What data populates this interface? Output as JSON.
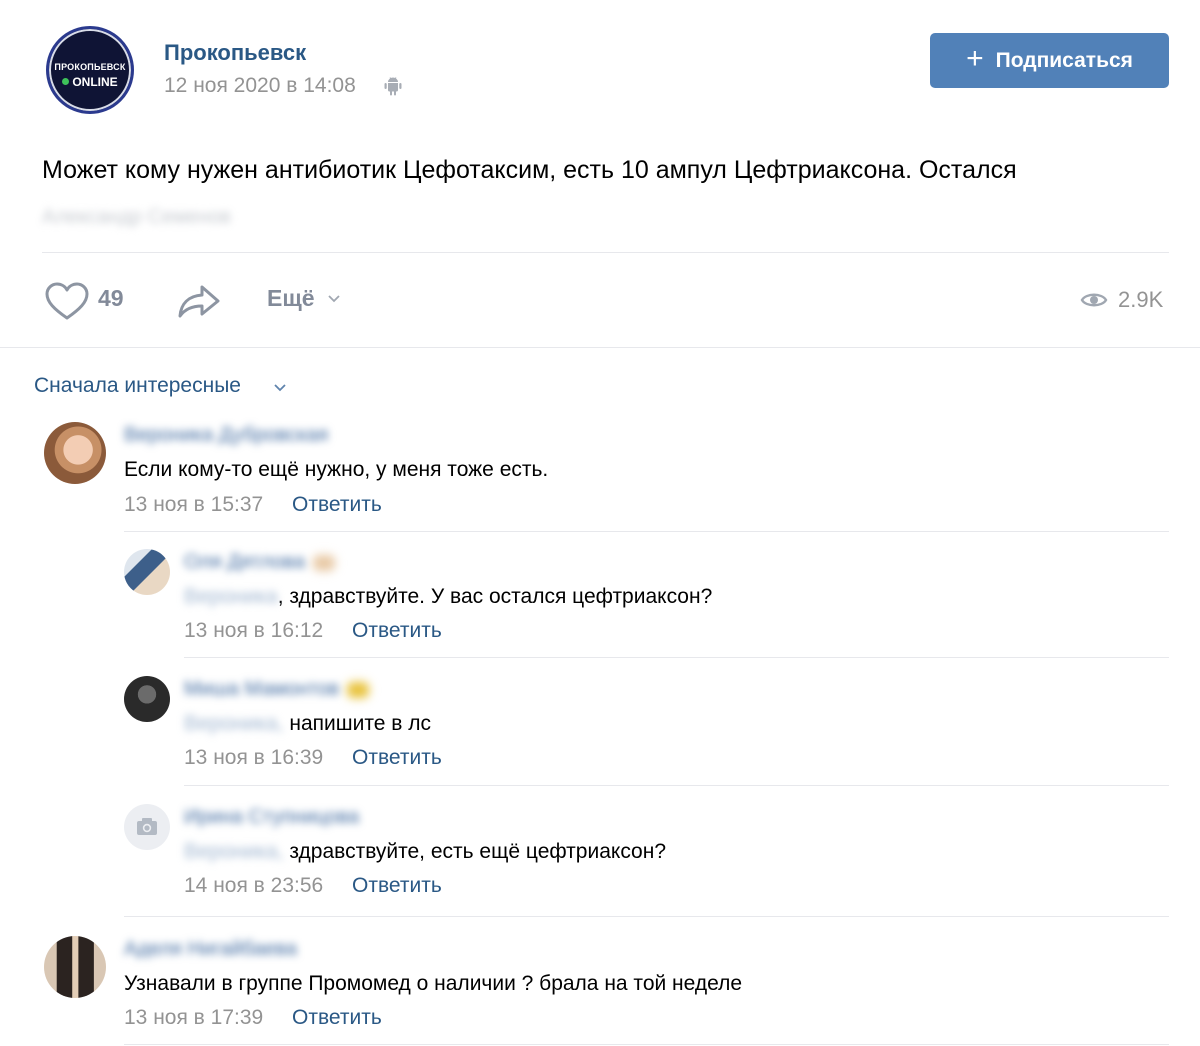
{
  "post": {
    "group_name": "Прокопьевск",
    "avatar_text_top": "ПРОКОПЬЕВСК",
    "avatar_text_bottom": "ONLINE",
    "date": "12 ноя 2020 в 14:08",
    "platform_icon": "android-icon",
    "subscribe_label": "Подписаться",
    "text": "Может кому нужен антибиотик Цефотаксим, есть 10 ампул Цефтриаксона. Остался",
    "signer": "Александр Семенов"
  },
  "actions": {
    "like_count": "49",
    "more_label": "Ещё",
    "views": "2.9K"
  },
  "comments_sort": "Сначала интересные",
  "colors": {
    "link": "#2a5885",
    "button": "#5181b8",
    "meta": "#939393",
    "divider": "#e7e8ec"
  },
  "comments": [
    {
      "author": "Вероника Дубровская",
      "text": "Если кому-то ещё нужно, у меня тоже есть.",
      "date": "13 ноя в 15:37",
      "reply_label": "Ответить"
    },
    {
      "author": "Оля Дятлова",
      "mention": "Вероника",
      "text": ", здравствуйте. У вас остался цефтриаксон?",
      "date": "13 ноя в 16:12",
      "reply_label": "Ответить"
    },
    {
      "author": "Миша Мамонтов",
      "mention": "Вероника,",
      "text": " напишите в лс",
      "date": "13 ноя в 16:39",
      "reply_label": "Ответить"
    },
    {
      "author": "Ирина Ступницова",
      "mention": "Вероника,",
      "text": " здравствуйте, есть ещё цефтриаксон?",
      "date": "14 ноя в 23:56",
      "reply_label": "Ответить"
    },
    {
      "author": "Аделя Нигайбаева",
      "text": "Узнавали в группе Промомед о наличии ? брала на той неделе",
      "date": "13 ноя в 17:39",
      "reply_label": "Ответить"
    }
  ]
}
